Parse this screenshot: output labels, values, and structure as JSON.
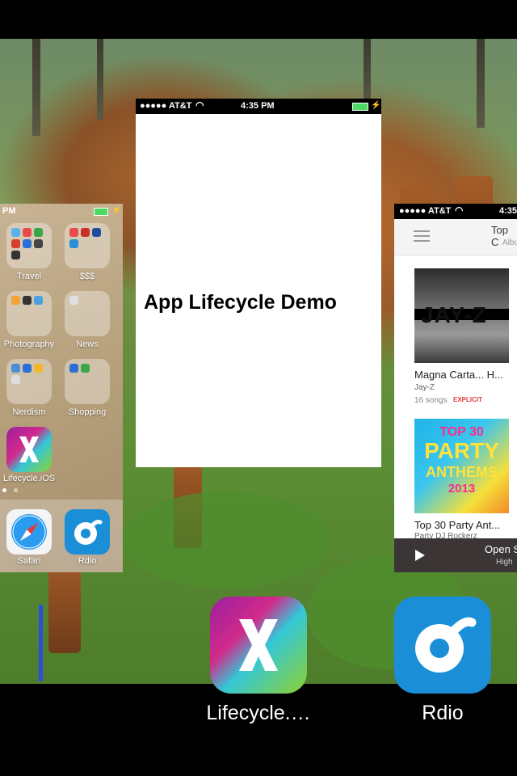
{
  "left_card": {
    "status_time": "PM",
    "folders": [
      {
        "label": "Travel"
      },
      {
        "label": "$$$"
      },
      {
        "label": "Photography"
      },
      {
        "label": "News"
      },
      {
        "label": "Nerdism"
      },
      {
        "label": "Shopping"
      }
    ],
    "app_label": "Lifecycle.iOS",
    "dock": [
      {
        "label": "Safari"
      },
      {
        "label": "Rdio"
      }
    ]
  },
  "center_card": {
    "carrier": "●●●●● AT&T",
    "time": "4:35 PM",
    "title": "App Lifecycle Demo"
  },
  "right_card": {
    "carrier": "●●●●● AT&T",
    "time": "4:35",
    "nav_title": "Top C",
    "nav_subtitle": "Albu",
    "albums": [
      {
        "title": "Magna Carta... H...",
        "artist": "Jay-Z",
        "count": "16 songs",
        "badge": "EXPLICIT",
        "art_text": "JAY-Z"
      },
      {
        "title": "Top 30 Party Ant...",
        "artist": "Party DJ Rockerz",
        "art_line1": "TOP 30",
        "art_line2": "PARTY",
        "art_line3": "ANTHEMS",
        "art_line4": "2013"
      }
    ],
    "player_title": "Open S",
    "player_sub": "High"
  },
  "switcher_icons": [
    {
      "label": "Lifecycle.…"
    },
    {
      "label": "Rdio"
    }
  ],
  "colors": {
    "battery": "#4cd964",
    "explicit": "#e23b3b",
    "rdio_blue": "#1a8fd8"
  }
}
